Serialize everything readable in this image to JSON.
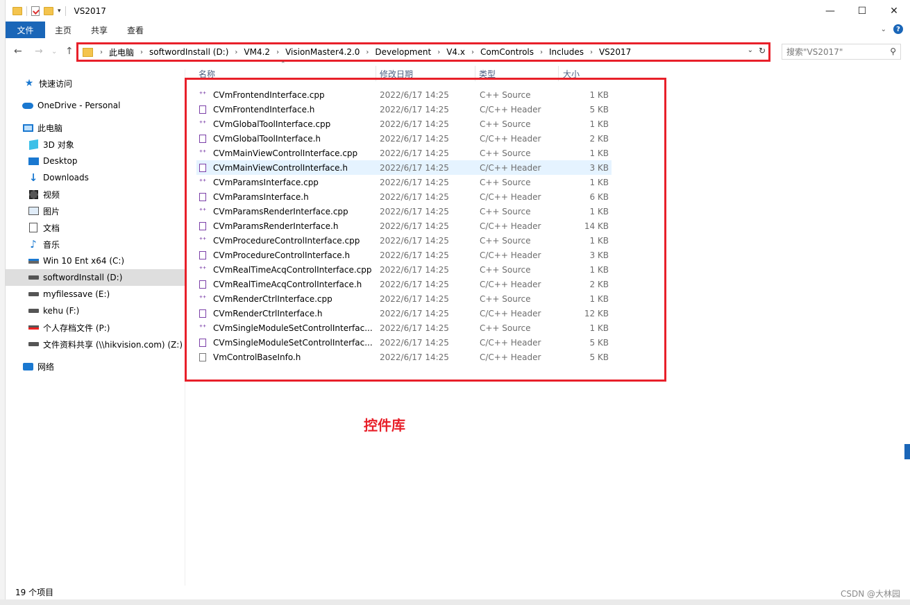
{
  "window": {
    "title": "VS2017",
    "minimize_glyph": "—",
    "maximize_glyph": "☐",
    "close_glyph": "✕"
  },
  "ribbon": {
    "tabs": [
      {
        "label": "文件"
      },
      {
        "label": "主页"
      },
      {
        "label": "共享"
      },
      {
        "label": "查看"
      }
    ]
  },
  "nav": {
    "back_glyph": "←",
    "forward_glyph": "→",
    "up_glyph": "↑",
    "breadcrumbs": [
      "此电脑",
      "softwordInstall (D:)",
      "VM4.2",
      "VisionMaster4.2.0",
      "Development",
      "V4.x",
      "ComControls",
      "Includes",
      "VS2017"
    ]
  },
  "search": {
    "placeholder": "搜索\"VS2017\""
  },
  "sidebar": {
    "items": [
      {
        "label": "快速访问",
        "icon": "star-icon"
      },
      {
        "label": "OneDrive - Personal",
        "icon": "cloud-icon"
      },
      {
        "label": "此电脑",
        "icon": "computer-icon"
      },
      {
        "label": "3D 对象",
        "icon": "3d-objects-icon"
      },
      {
        "label": "Desktop",
        "icon": "desktop-icon"
      },
      {
        "label": "Downloads",
        "icon": "download-icon"
      },
      {
        "label": "视频",
        "icon": "video-icon"
      },
      {
        "label": "图片",
        "icon": "pictures-icon"
      },
      {
        "label": "文档",
        "icon": "documents-icon"
      },
      {
        "label": "音乐",
        "icon": "music-icon"
      },
      {
        "label": "Win 10 Ent x64 (C:)",
        "icon": "windows-drive-icon"
      },
      {
        "label": "softwordInstall (D:)",
        "icon": "drive-icon",
        "selected": true
      },
      {
        "label": "myfilessave (E:)",
        "icon": "drive-icon"
      },
      {
        "label": "kehu (F:)",
        "icon": "drive-icon"
      },
      {
        "label": "个人存档文件 (P:)",
        "icon": "network-drive-disconnected-icon"
      },
      {
        "label": "文件资料共享 (\\\\hikvision.com) (Z:)",
        "icon": "network-drive-icon"
      },
      {
        "label": "网络",
        "icon": "network-icon"
      }
    ]
  },
  "columns": {
    "name": "名称",
    "date": "修改日期",
    "type": "类型",
    "size": "大小"
  },
  "files": [
    {
      "name": "CVmFrontendInterface.cpp",
      "date": "2022/6/17 14:25",
      "type": "C++ Source",
      "size": "1 KB",
      "kind": "cpp"
    },
    {
      "name": "CVmFrontendInterface.h",
      "date": "2022/6/17 14:25",
      "type": "C/C++ Header",
      "size": "5 KB",
      "kind": "h"
    },
    {
      "name": "CVmGlobalToolInterface.cpp",
      "date": "2022/6/17 14:25",
      "type": "C++ Source",
      "size": "1 KB",
      "kind": "cpp"
    },
    {
      "name": "CVmGlobalToolInterface.h",
      "date": "2022/6/17 14:25",
      "type": "C/C++ Header",
      "size": "2 KB",
      "kind": "h"
    },
    {
      "name": "CVmMainViewControlInterface.cpp",
      "date": "2022/6/17 14:25",
      "type": "C++ Source",
      "size": "1 KB",
      "kind": "cpp"
    },
    {
      "name": "CVmMainViewControlInterface.h",
      "date": "2022/6/17 14:25",
      "type": "C/C++ Header",
      "size": "3 KB",
      "kind": "h",
      "hover": true
    },
    {
      "name": "CVmParamsInterface.cpp",
      "date": "2022/6/17 14:25",
      "type": "C++ Source",
      "size": "1 KB",
      "kind": "cpp"
    },
    {
      "name": "CVmParamsInterface.h",
      "date": "2022/6/17 14:25",
      "type": "C/C++ Header",
      "size": "6 KB",
      "kind": "h"
    },
    {
      "name": "CVmParamsRenderInterface.cpp",
      "date": "2022/6/17 14:25",
      "type": "C++ Source",
      "size": "1 KB",
      "kind": "cpp"
    },
    {
      "name": "CVmParamsRenderInterface.h",
      "date": "2022/6/17 14:25",
      "type": "C/C++ Header",
      "size": "14 KB",
      "kind": "h"
    },
    {
      "name": "CVmProcedureControlInterface.cpp",
      "date": "2022/6/17 14:25",
      "type": "C++ Source",
      "size": "1 KB",
      "kind": "cpp"
    },
    {
      "name": "CVmProcedureControlInterface.h",
      "date": "2022/6/17 14:25",
      "type": "C/C++ Header",
      "size": "3 KB",
      "kind": "h"
    },
    {
      "name": "CVmRealTimeAcqControlInterface.cpp",
      "date": "2022/6/17 14:25",
      "type": "C++ Source",
      "size": "1 KB",
      "kind": "cpp"
    },
    {
      "name": "CVmRealTimeAcqControlInterface.h",
      "date": "2022/6/17 14:25",
      "type": "C/C++ Header",
      "size": "2 KB",
      "kind": "h"
    },
    {
      "name": "CVmRenderCtrlInterface.cpp",
      "date": "2022/6/17 14:25",
      "type": "C++ Source",
      "size": "1 KB",
      "kind": "cpp"
    },
    {
      "name": "CVmRenderCtrlInterface.h",
      "date": "2022/6/17 14:25",
      "type": "C/C++ Header",
      "size": "12 KB",
      "kind": "h"
    },
    {
      "name": "CVmSingleModuleSetControlInterfac...",
      "date": "2022/6/17 14:25",
      "type": "C++ Source",
      "size": "1 KB",
      "kind": "cpp"
    },
    {
      "name": "CVmSingleModuleSetControlInterfac...",
      "date": "2022/6/17 14:25",
      "type": "C/C++ Header",
      "size": "5 KB",
      "kind": "h"
    },
    {
      "name": "VmControlBaseInfo.h",
      "date": "2022/6/17 14:25",
      "type": "C/C++ Header",
      "size": "5 KB",
      "kind": "plain"
    }
  ],
  "annotation": "控件库",
  "status": {
    "item_count": "19 个项目"
  },
  "watermark": "CSDN @大林园",
  "colors": {
    "highlight_red": "#e8202a",
    "accent_blue": "#1a66b8",
    "cpp_purple": "#7b3fa8"
  }
}
